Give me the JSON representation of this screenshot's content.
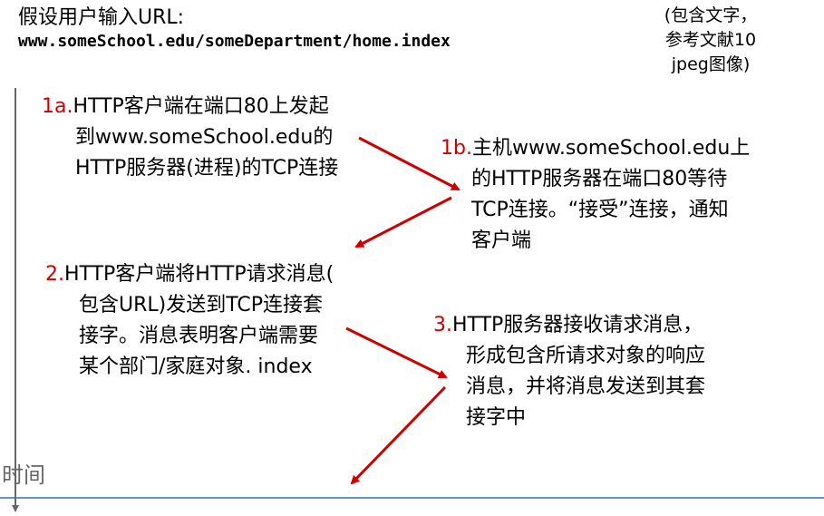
{
  "header": {
    "title": "假设用户输入URL:",
    "url": "www.someSchool.edu/someDepartment/home.index",
    "note_lines": [
      "(包含文字，",
      "参考文献10",
      "jpeg图像)"
    ]
  },
  "steps": [
    {
      "id": "1a",
      "number": "1a.",
      "lines": [
        "HTTP客户端在端口80上发起",
        "到www.someSchool.edu的",
        "HTTP服务器(进程)的TCP连接"
      ]
    },
    {
      "id": "1b",
      "number": "1b.",
      "lines": [
        "主机www.someSchool.edu上",
        "的HTTP服务器在端口80等待",
        "TCP连接。“接受”连接，通知",
        "客户端"
      ]
    },
    {
      "id": "2",
      "number": "2.",
      "lines": [
        "HTTP客户端将HTTP请求消息(",
        "包含URL)发送到TCP连接套",
        "接字。消息表明客户端需要",
        "某个部门/家庭对象. index"
      ]
    },
    {
      "id": "3",
      "number": "3.",
      "lines": [
        "HTTP服务器接收请求消息，",
        "形成包含所请求对象的响应",
        "消息，并将消息发送到其套",
        "接字中"
      ]
    }
  ],
  "timeline": {
    "label": "时间"
  },
  "colors": {
    "step_number": "#cc0000",
    "arrow": "#cc0000",
    "timeline": "#666666",
    "footer_line": "#2e75b6"
  }
}
